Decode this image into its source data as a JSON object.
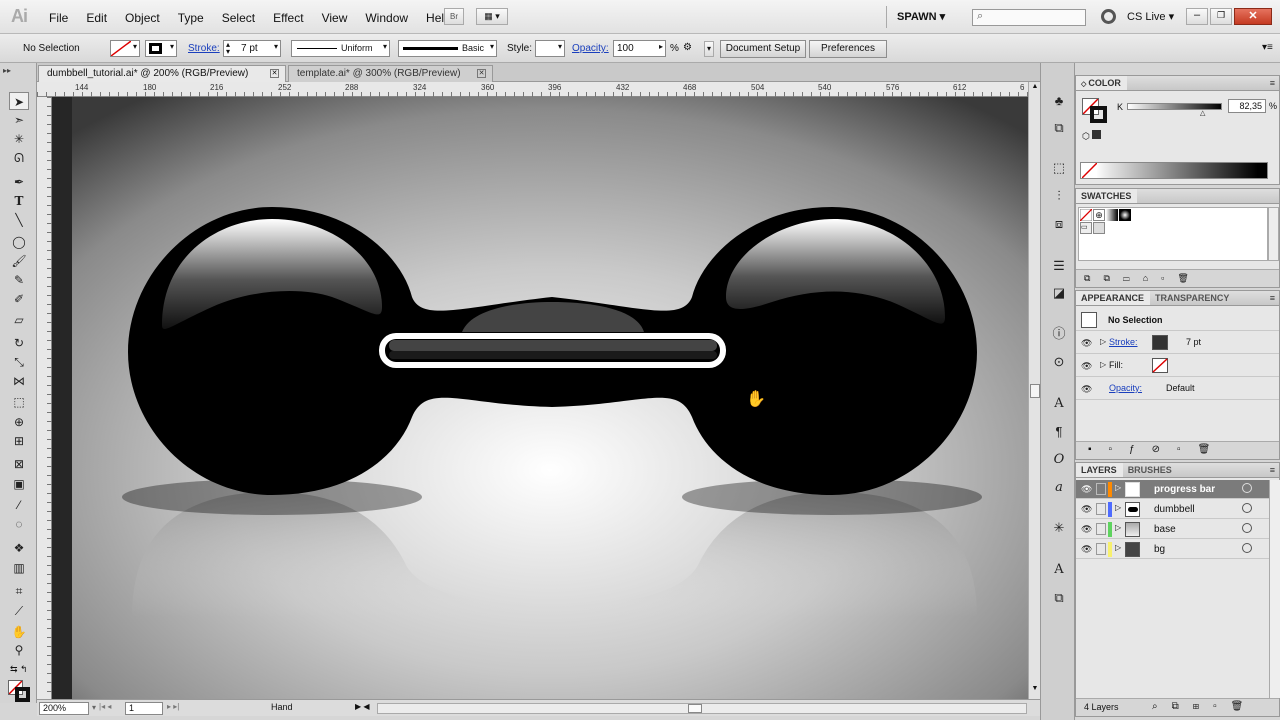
{
  "app": {
    "logo": "Ai",
    "workspace": "SPAWN",
    "cslive": "CS Live",
    "bridge": "Br"
  },
  "menu": [
    "File",
    "Edit",
    "Object",
    "Type",
    "Select",
    "Effect",
    "View",
    "Window",
    "Help"
  ],
  "control": {
    "selection": "No Selection",
    "stroke_label": "Stroke:",
    "stroke_value": "7 pt",
    "profile": "Uniform",
    "brush": "Basic",
    "style_label": "Style:",
    "opacity_label": "Opacity:",
    "opacity_value": "100",
    "opacity_unit": "%",
    "doc_setup": "Document Setup",
    "preferences": "Preferences"
  },
  "tabs": [
    {
      "label": "dumbbell_tutorial.ai* @ 200% (RGB/Preview)",
      "active": true
    },
    {
      "label": "template.ai* @ 300% (RGB/Preview)",
      "active": false
    }
  ],
  "ruler": {
    "h": [
      "144",
      "180",
      "216",
      "252",
      "288",
      "324",
      "360",
      "396",
      "432",
      "468",
      "504",
      "540",
      "576",
      "612",
      "6"
    ]
  },
  "status": {
    "zoom": "200%",
    "page": "1",
    "tool": "Hand"
  },
  "color_panel": {
    "title": "COLOR",
    "channel": "K",
    "value": "82,35",
    "unit": "%"
  },
  "swatches_panel": {
    "title": "SWATCHES"
  },
  "appearance_panel": {
    "tab1": "APPEARANCE",
    "tab2": "TRANSPARENCY",
    "header": "No Selection",
    "stroke_label": "Stroke:",
    "stroke_value": "7 pt",
    "fill_label": "Fill:",
    "opacity_label": "Opacity:",
    "opacity_value": "Default"
  },
  "layers_panel": {
    "tab1": "LAYERS",
    "tab2": "BRUSHES",
    "layers": [
      {
        "name": "progress bar",
        "color": "#ff8a00",
        "selected": true
      },
      {
        "name": "dumbbell",
        "color": "#4f6cff",
        "selected": false
      },
      {
        "name": "base",
        "color": "#5fd35f",
        "selected": false
      },
      {
        "name": "bg",
        "color": "#f7f06e",
        "selected": false
      }
    ],
    "count": "4 Layers"
  }
}
